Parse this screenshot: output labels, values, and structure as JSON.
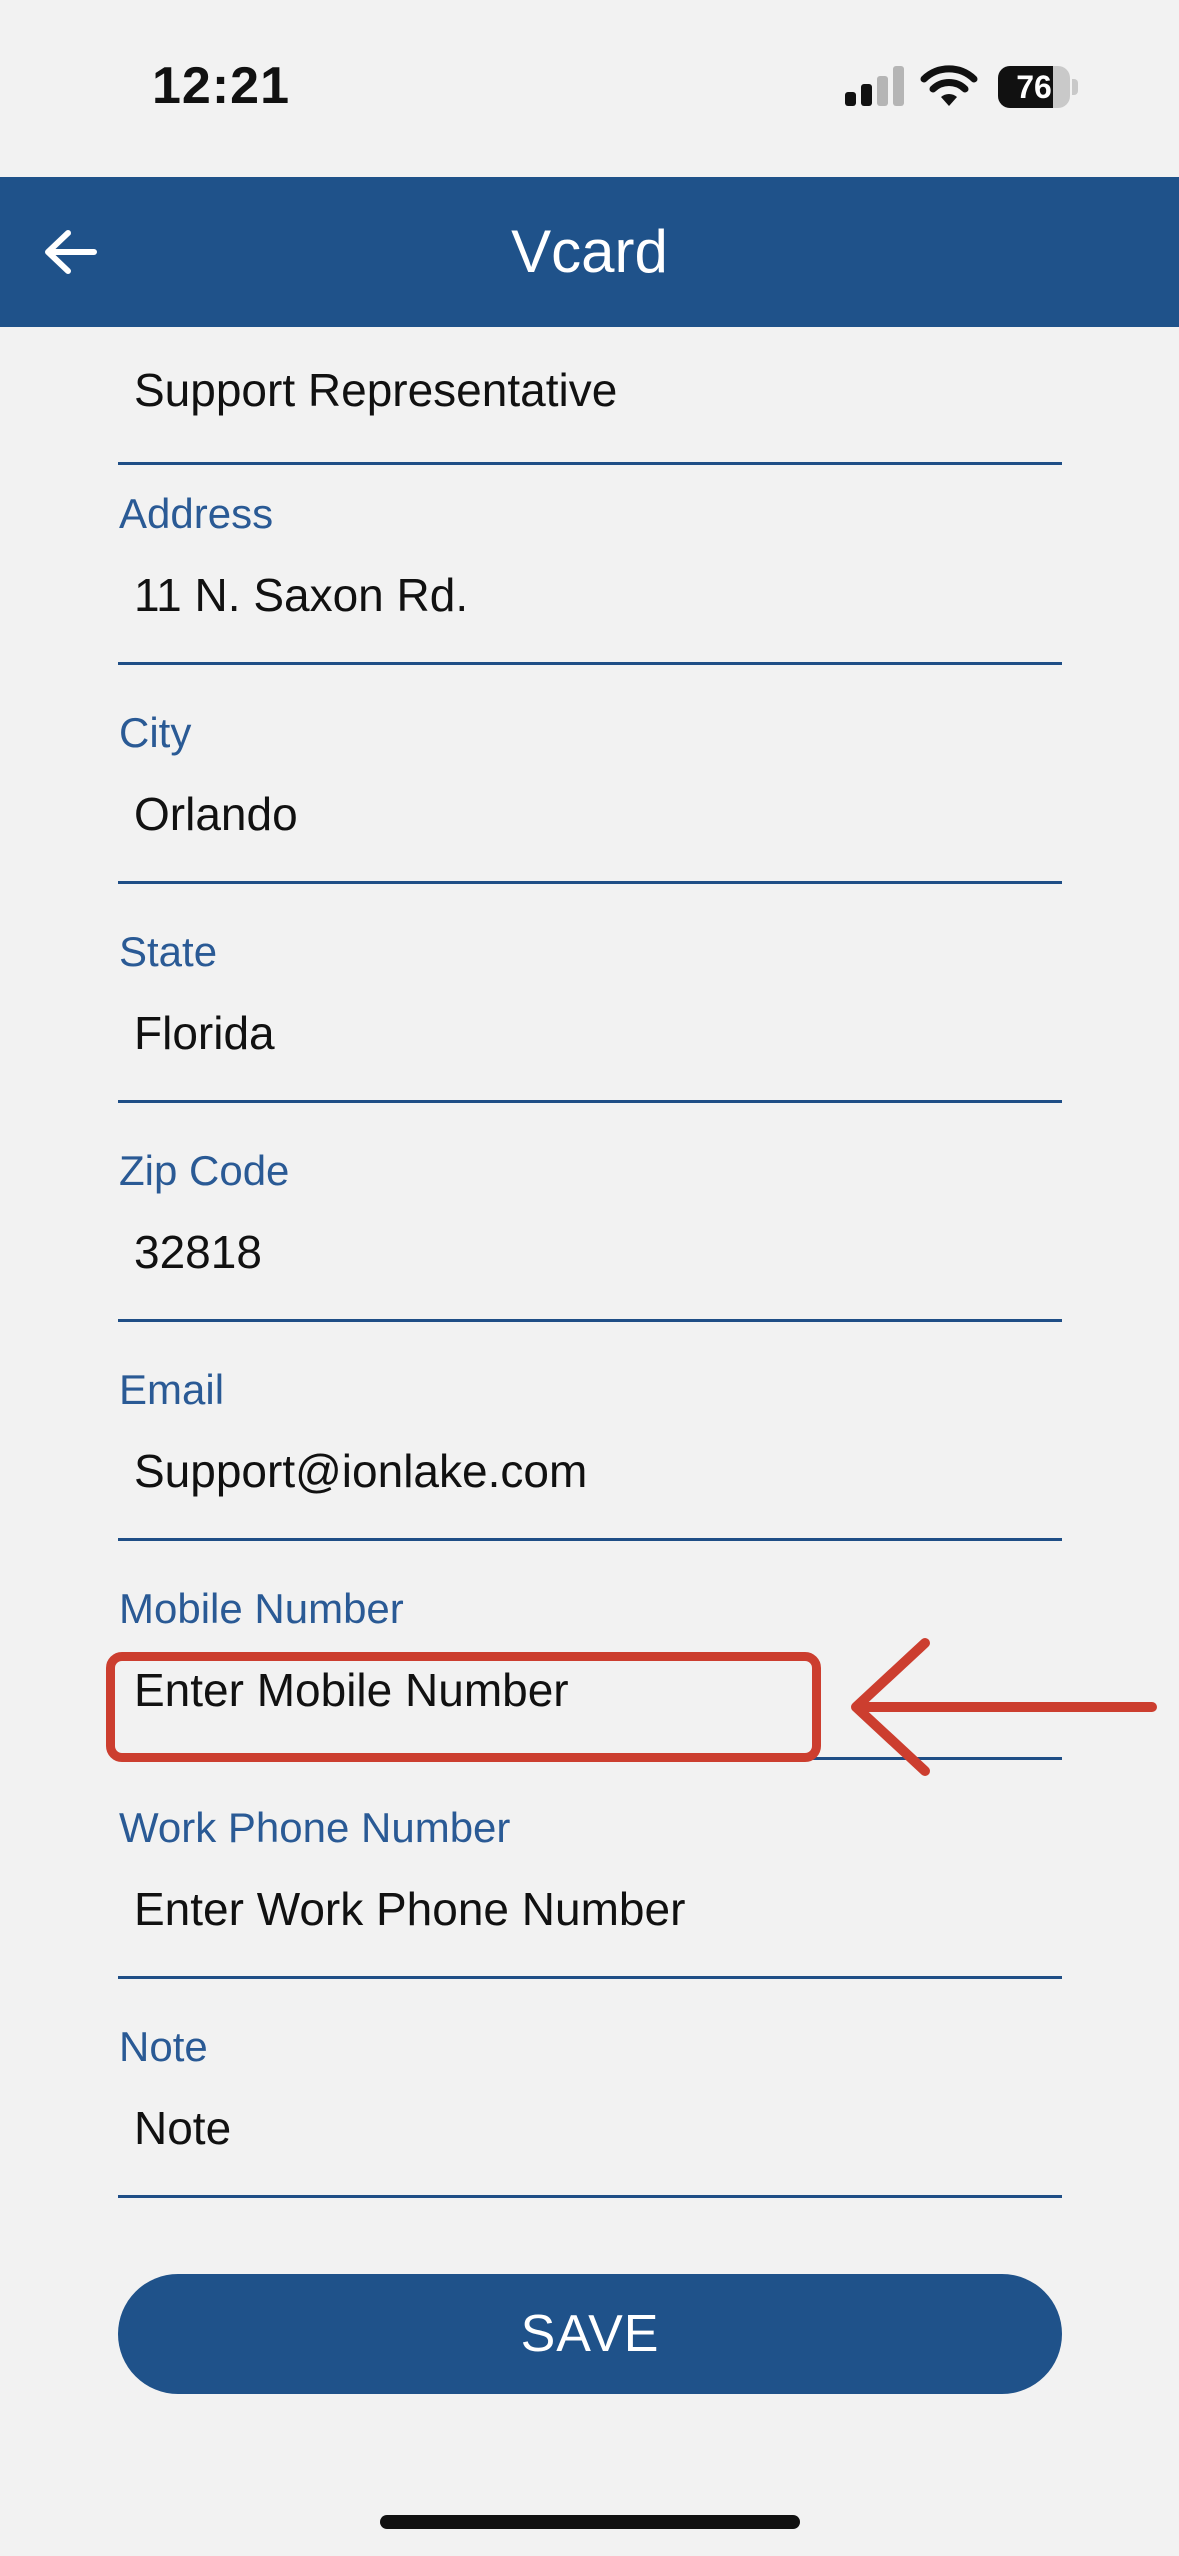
{
  "status_bar": {
    "time": "12:21",
    "battery_level": "76",
    "battery_fraction": 0.76,
    "signal_bars_active": 2,
    "signal_bars_total": 4,
    "icons": [
      "signal-icon",
      "wifi-icon",
      "battery-icon"
    ]
  },
  "header": {
    "title": "Vcard",
    "back_icon": "arrow-left-icon",
    "background_color": "#1f528a"
  },
  "form": {
    "fields": [
      {
        "label": "",
        "value": "Support Representative",
        "placeholder": ""
      },
      {
        "label": "Address",
        "value": "11 N. Saxon Rd.",
        "placeholder": ""
      },
      {
        "label": "City",
        "value": "Orlando",
        "placeholder": ""
      },
      {
        "label": "State",
        "value": "Florida",
        "placeholder": ""
      },
      {
        "label": "Zip Code",
        "value": "32818",
        "placeholder": ""
      },
      {
        "label": "Email",
        "value": "Support@ionlake.com",
        "placeholder": ""
      },
      {
        "label": "Mobile Number",
        "value": "",
        "placeholder": "Enter Mobile Number"
      },
      {
        "label": "Work Phone Number",
        "value": "",
        "placeholder": "Enter Work Phone Number"
      },
      {
        "label": "Note",
        "value": "",
        "placeholder": "Note"
      }
    ],
    "label_color": "#2a5a95"
  },
  "actions": {
    "save_label": "SAVE"
  },
  "annotation": {
    "highlight_color": "#cc3e2f",
    "target": "Mobile Number"
  }
}
